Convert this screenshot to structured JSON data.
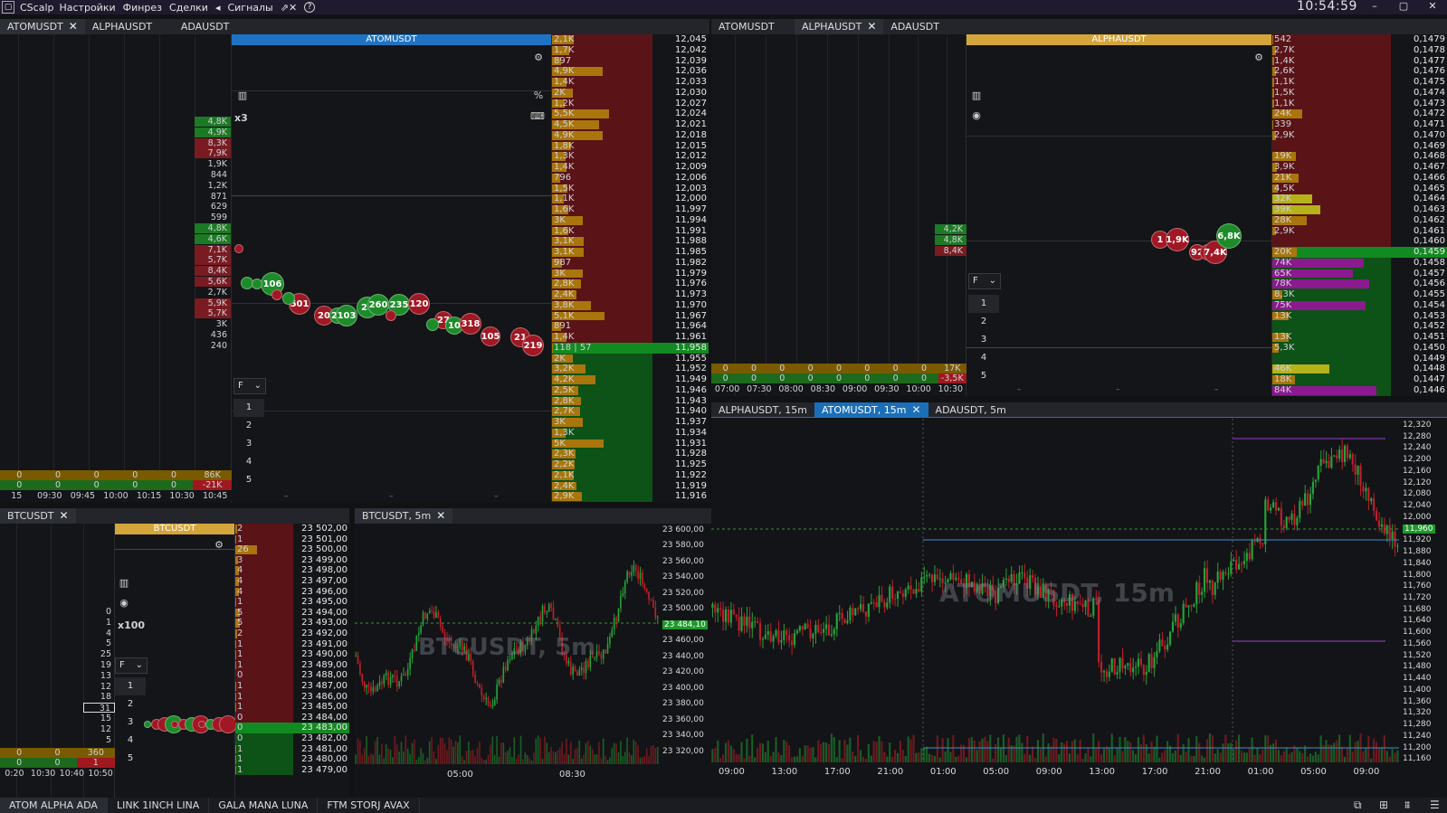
{
  "app": {
    "title": "CScalp",
    "menu": [
      "Настройки",
      "Финрез",
      "Сделки",
      "Сигналы"
    ],
    "clock": "10:54:59"
  },
  "left_tabs": [
    {
      "label": "ATOMUSDT",
      "active": true
    },
    {
      "label": "ALPHAUSDT"
    },
    {
      "label": "ADAUSDT"
    }
  ],
  "right_tabs": [
    {
      "label": "ATOMUSDT"
    },
    {
      "label": "ALPHAUSDT",
      "active": true
    },
    {
      "label": "ADAUSDT"
    }
  ],
  "chart_tabs_right": [
    {
      "label": "ALPHAUSDT, 15m"
    },
    {
      "label": "ATOMUSDT, 15m",
      "active": true
    },
    {
      "label": "ADAUSDT, 5m"
    }
  ],
  "btc_tab": "BTCUSDT",
  "btc_chart_tab": "BTCUSDT, 5m",
  "atom": {
    "header": "ATOMUSDT",
    "multiplier": "x3",
    "filter": "F",
    "levels": [
      "1",
      "2",
      "3",
      "4",
      "5"
    ],
    "cluster_vols": [
      "4,8K",
      "4,9K",
      "8,3K",
      "7,9K",
      "1,9K",
      "844",
      "1,2K",
      "871",
      "629",
      "599",
      "4,8K",
      "4,6K",
      "7,1K",
      "5,7K",
      "8,4K",
      "5,6K",
      "2,7K",
      "5,9K",
      "5,7K",
      "3K",
      "436",
      "240"
    ],
    "bottom_row1": [
      "0",
      "0",
      "0",
      "0",
      "0",
      "86K"
    ],
    "bottom_row2": [
      "0",
      "0",
      "0",
      "0",
      "0",
      "-21K"
    ],
    "time_labels": [
      "15",
      "09:30",
      "09:45",
      "10:00",
      "10:15",
      "10:30",
      "10:45"
    ],
    "bubbles": [
      "106",
      "501",
      "20",
      "24",
      "103",
      "24",
      "260",
      "235",
      "120",
      "27",
      "10",
      "318",
      "105",
      "21",
      "219"
    ],
    "book": [
      [
        "2,1K",
        "12,045"
      ],
      [
        "1,7K",
        "12,042"
      ],
      [
        "897",
        "12,039"
      ],
      [
        "4,9K",
        "12,036"
      ],
      [
        "1,4K",
        "12,033"
      ],
      [
        "2K",
        "12,030"
      ],
      [
        "1,2K",
        "12,027"
      ],
      [
        "5,5K",
        "12,024"
      ],
      [
        "4,5K",
        "12,021"
      ],
      [
        "4,9K",
        "12,018"
      ],
      [
        "1,8K",
        "12,015"
      ],
      [
        "1,3K",
        "12,012"
      ],
      [
        "1,4K",
        "12,009"
      ],
      [
        "796",
        "12,006"
      ],
      [
        "1,5K",
        "12,003"
      ],
      [
        "1,1K",
        "12,000"
      ],
      [
        "1,6K",
        "11,997"
      ],
      [
        "3K",
        "11,994"
      ],
      [
        "1,6K",
        "11,991"
      ],
      [
        "3,1K",
        "11,988"
      ],
      [
        "3,1K",
        "11,985"
      ],
      [
        "987",
        "11,982"
      ],
      [
        "3K",
        "11,979"
      ],
      [
        "2,8K",
        "11,976"
      ],
      [
        "2,4K",
        "11,973"
      ],
      [
        "3,8K",
        "11,970"
      ],
      [
        "5,1K",
        "11,967"
      ],
      [
        "891",
        "11,964"
      ],
      [
        "1,4K",
        "11,961"
      ],
      [
        "118 | 57",
        "11,958"
      ],
      [
        "2K",
        "11,955"
      ],
      [
        "3,2K",
        "11,952"
      ],
      [
        "4,2K",
        "11,949"
      ],
      [
        "2,5K",
        "11,946"
      ],
      [
        "2,8K",
        "11,943"
      ],
      [
        "2,7K",
        "11,940"
      ],
      [
        "3K",
        "11,937"
      ],
      [
        "1,3K",
        "11,934"
      ],
      [
        "5K",
        "11,931"
      ],
      [
        "2,3K",
        "11,928"
      ],
      [
        "2,2K",
        "11,925"
      ],
      [
        "2,1K",
        "11,922"
      ],
      [
        "2,4K",
        "11,919"
      ],
      [
        "2,9K",
        "11,916"
      ]
    ]
  },
  "alpha": {
    "header": "ALPHAUSDT",
    "filter": "F",
    "levels": [
      "1",
      "2",
      "3",
      "4",
      "5"
    ],
    "cluster_vols": [
      "4,2K",
      "4,8K",
      "8,4K"
    ],
    "bottom_row1": [
      "0",
      "0",
      "0",
      "0",
      "0",
      "0",
      "0",
      "0",
      "17K"
    ],
    "bottom_row2": [
      "0",
      "0",
      "0",
      "0",
      "0",
      "0",
      "0",
      "0",
      "-3,5K"
    ],
    "time_labels": [
      "07:00",
      "07:30",
      "08:00",
      "08:30",
      "09:00",
      "09:30",
      "10:00",
      "10:30"
    ],
    "bubbles": [
      "1",
      "1,9K",
      "92",
      "1",
      "7,4K",
      "6,8K"
    ],
    "book": [
      [
        "542",
        "0,1479"
      ],
      [
        "2,7K",
        "0,1478"
      ],
      [
        "1,4K",
        "0,1477"
      ],
      [
        "2,6K",
        "0,1476"
      ],
      [
        "1,1K",
        "0,1475"
      ],
      [
        "1,5K",
        "0,1474"
      ],
      [
        "1,1K",
        "0,1473"
      ],
      [
        "24K",
        "0,1472"
      ],
      [
        "339",
        "0,1471"
      ],
      [
        "2,9K",
        "0,1470"
      ],
      [
        "",
        "0,1469"
      ],
      [
        "19K",
        "0,1468"
      ],
      [
        "3,9K",
        "0,1467"
      ],
      [
        "21K",
        "0,1466"
      ],
      [
        "4,5K",
        "0,1465"
      ],
      [
        "32K",
        "0,1464"
      ],
      [
        "39K",
        "0,1463"
      ],
      [
        "28K",
        "0,1462"
      ],
      [
        "2,9K",
        "0,1461"
      ],
      [
        "",
        "0,1460"
      ],
      [
        "20K",
        "0,1459"
      ],
      [
        "74K",
        "0,1458"
      ],
      [
        "65K",
        "0,1457"
      ],
      [
        "78K",
        "0,1456"
      ],
      [
        "8,3K",
        "0,1455"
      ],
      [
        "75K",
        "0,1454"
      ],
      [
        "13K",
        "0,1453"
      ],
      [
        "",
        "0,1452"
      ],
      [
        "13K",
        "0,1451"
      ],
      [
        "5,3K",
        "0,1450"
      ],
      [
        "",
        "0,1449"
      ],
      [
        "46K",
        "0,1448"
      ],
      [
        "18K",
        "0,1447"
      ],
      [
        "84K",
        "0,1446"
      ]
    ]
  },
  "btc": {
    "header": "BTCUSDT",
    "multiplier": "x100",
    "filter": "F",
    "levels": [
      "1",
      "2",
      "3",
      "4",
      "5"
    ],
    "cluster_vols": [
      "0",
      "1",
      "4",
      "5",
      "25",
      "19",
      "13",
      "12",
      "18",
      "31",
      "15",
      "12",
      "5"
    ],
    "bottom_row1": [
      "0",
      "0",
      "360"
    ],
    "bottom_row2": [
      "0",
      "0",
      "1"
    ],
    "time_labels": [
      "0:20",
      "10:30",
      "10:40",
      "10:50"
    ],
    "book": [
      [
        "2",
        "23 502,00"
      ],
      [
        "1",
        "23 501,00"
      ],
      [
        "26",
        "23 500,00"
      ],
      [
        "3",
        "23 499,00"
      ],
      [
        "4",
        "23 498,00"
      ],
      [
        "4",
        "23 497,00"
      ],
      [
        "4",
        "23 496,00"
      ],
      [
        "1",
        "23 495,00"
      ],
      [
        "5",
        "23 494,00"
      ],
      [
        "5",
        "23 493,00"
      ],
      [
        "2",
        "23 492,00"
      ],
      [
        "1",
        "23 491,00"
      ],
      [
        "1",
        "23 490,00"
      ],
      [
        "1",
        "23 489,00"
      ],
      [
        "0",
        "23 488,00"
      ],
      [
        "1",
        "23 487,00"
      ],
      [
        "1",
        "23 486,00"
      ],
      [
        "1",
        "23 485,00"
      ],
      [
        "0",
        "23 484,00"
      ],
      [
        "0",
        "23 483,00"
      ],
      [
        "0",
        "23 482,00"
      ],
      [
        "1",
        "23 481,00"
      ],
      [
        "1",
        "23 480,00"
      ],
      [
        "1",
        "23 479,00"
      ]
    ]
  },
  "btc_chart": {
    "watermark": "BTCUSDT, 5m",
    "yticks": [
      "23 600,00",
      "23 580,00",
      "23 560,00",
      "23 540,00",
      "23 520,00",
      "23 500,00",
      "23 484,10",
      "23 460,00",
      "23 440,00",
      "23 420,00",
      "23 400,00",
      "23 380,00",
      "23 360,00",
      "23 340,00",
      "23 320,00"
    ],
    "xticks": [
      "05:00",
      "08:30"
    ]
  },
  "atom_chart": {
    "watermark": "ATOMUSDT, 15m",
    "yticks": [
      "12,320",
      "12,280",
      "12,240",
      "12,200",
      "12,160",
      "12,120",
      "12,080",
      "12,040",
      "12,000",
      "11,960",
      "11,920",
      "11,880",
      "11,840",
      "11,800",
      "11,760",
      "11,720",
      "11,680",
      "11,640",
      "11,600",
      "11,560",
      "11,520",
      "11,480",
      "11,440",
      "11,400",
      "11,360",
      "11,320",
      "11,280",
      "11,240",
      "11,200",
      "11,160"
    ],
    "xticks": [
      "09:00",
      "13:00",
      "17:00",
      "21:00",
      "01:00",
      "05:00",
      "09:00",
      "13:00",
      "17:00",
      "21:00",
      "01:00",
      "05:00",
      "09:00"
    ]
  },
  "bottom_tabs": [
    "ATOM ALPHA ADA",
    "LINK 1INCH LINA",
    "GALA MANA LUNA",
    "FTM STORJ AVAX"
  ],
  "colors": {
    "bid": "#0d5216",
    "ask": "#5a1317",
    "bar_gold": "#a8760d",
    "accent_blue": "#1f73c4",
    "accent_gold": "#d3a53a"
  }
}
